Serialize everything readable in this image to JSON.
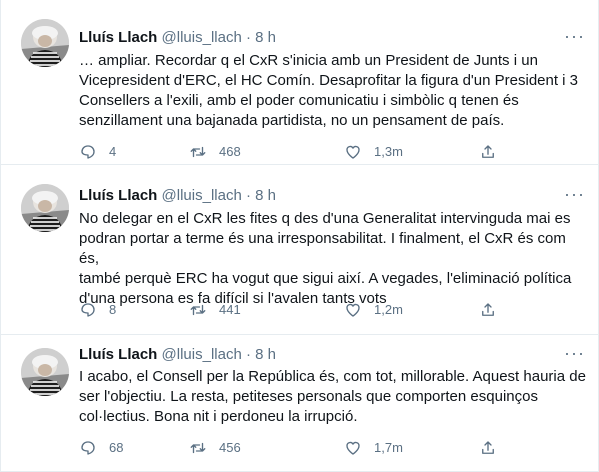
{
  "author": {
    "name": "Lluís Llach",
    "handle": "@lluis_llach",
    "separator": "·"
  },
  "more_glyph": "···",
  "tweets": [
    {
      "time": "8 h",
      "lines": [
        "…  ampliar. Recordar q el CxR s'inicia amb un President de Junts i un",
        "Vicepresident d'ERC, el HC Comín. Desaprofitar la figura d'un President i 3",
        "Consellers a l'exili, amb el poder comunicatiu i simbòlic q tenen és",
        "senzillament una bajanada partidista, no un pensament de país."
      ],
      "replies": "4",
      "retweets": "468",
      "likes": "1,3m"
    },
    {
      "time": "8 h",
      "lines": [
        "No delegar en el CxR les fites q des d'una Generalitat intervinguda mai es",
        "podran portar a terme és una irresponsabilitat. I finalment, el CxR és com és,",
        "també perquè ERC ha vogut que sigui així. A vegades, l'eliminació política",
        "d'una persona es fa difícil si l'avalen tants vots"
      ],
      "replies": "8",
      "retweets": "441",
      "likes": "1,2m"
    },
    {
      "time": "8 h",
      "lines": [
        "I acabo, el Consell per la República és, com tot, millorable. Aquest hauria de",
        "ser l'objectiu. La resta, petiteses personals que comporten esquinços",
        "col·lectius. Bona nit i perdoneu la irrupció."
      ],
      "replies": "68",
      "retweets": "456",
      "likes": "1,7m"
    }
  ]
}
